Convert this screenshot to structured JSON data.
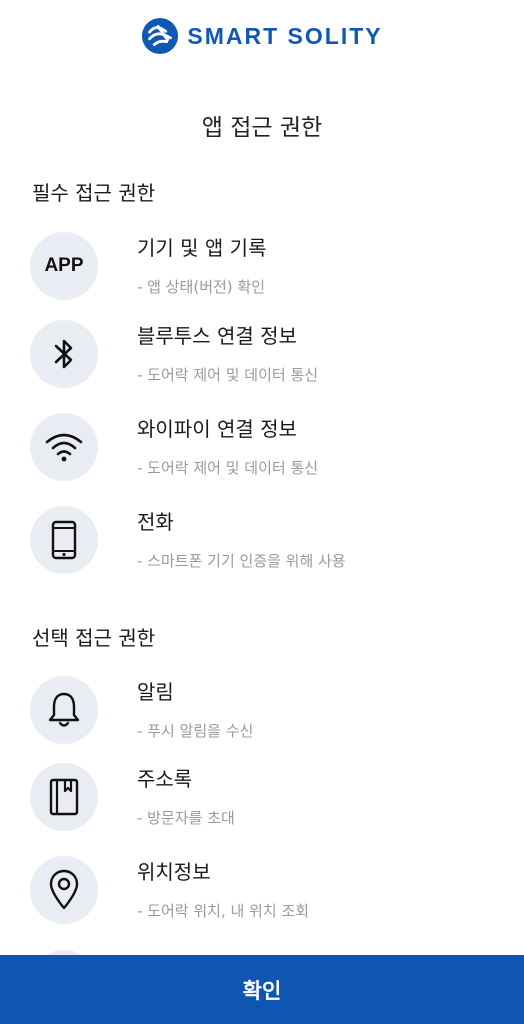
{
  "brand": {
    "name": "SMART SOLITY",
    "color": "#1157b5"
  },
  "page_title": "앱 접근 권한",
  "required": {
    "title": "필수 접근 권한",
    "items": [
      {
        "icon": "app-icon",
        "icon_text": "APP",
        "label": "기기 및 앱 기록",
        "desc": "- 앱 상태(버전) 확인"
      },
      {
        "icon": "bluetooth-icon",
        "label": "블루투스 연결 정보",
        "desc": "- 도어락 제어 및 데이터 통신"
      },
      {
        "icon": "wifi-icon",
        "label": "와이파이 연결 정보",
        "desc": "- 도어락 제어 및 데이터 통신"
      },
      {
        "icon": "phone-icon",
        "label": "전화",
        "desc": "- 스마트폰 기기 인증을 위해 사용"
      }
    ]
  },
  "optional": {
    "title": "선택 접근 권한",
    "items": [
      {
        "icon": "bell-icon",
        "label": "알림",
        "desc": "- 푸시 알림을 수신"
      },
      {
        "icon": "contacts-book-icon",
        "label": "주소록",
        "desc": "- 방문자를 초대"
      },
      {
        "icon": "location-pin-icon",
        "label": "위치정보",
        "desc": "- 도어락 위치, 내 위치 조회"
      }
    ]
  },
  "confirm_button": {
    "label": "확인",
    "color": "#0f56b3"
  }
}
